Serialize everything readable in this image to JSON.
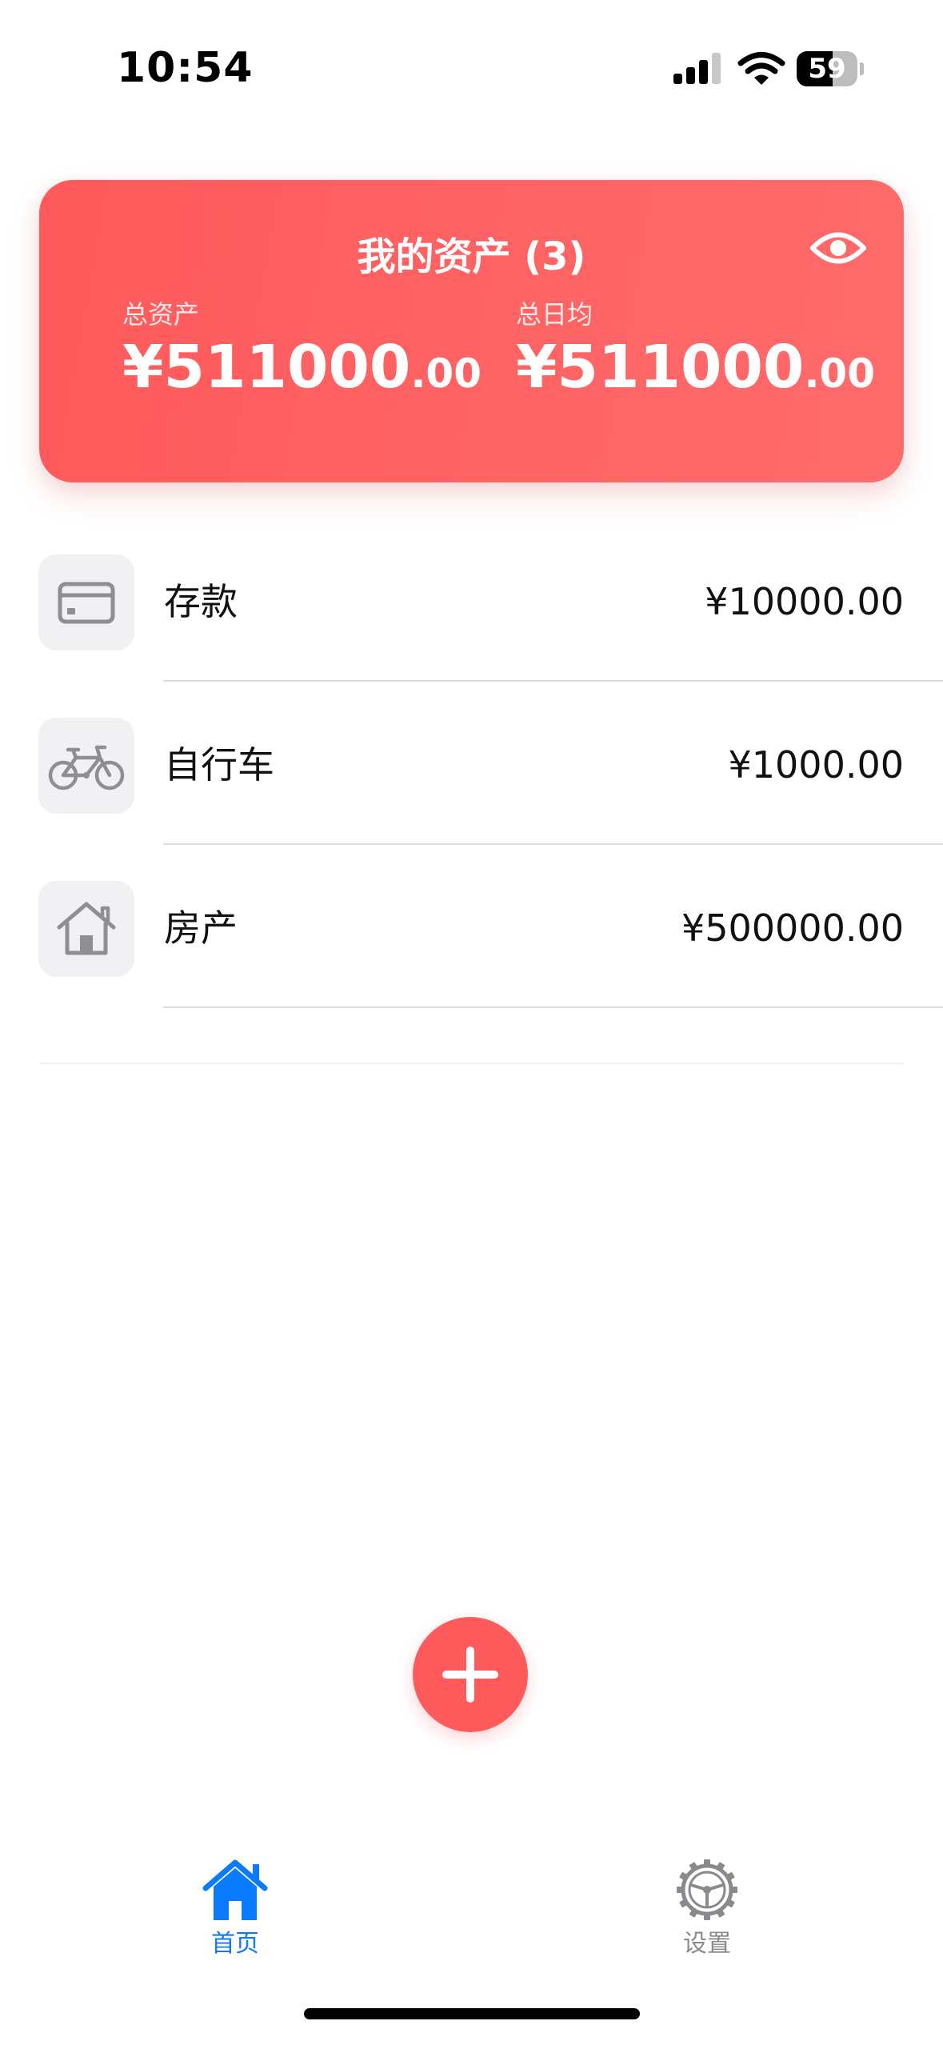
{
  "status_bar": {
    "time": "10:54",
    "battery_level": "59",
    "icons": [
      "signal-icon",
      "wifi-icon",
      "battery-icon"
    ]
  },
  "asset_card": {
    "title": "我的资产 (3)",
    "visibility_icon": "eye-icon",
    "total_assets": {
      "label": "总资产",
      "amount": "¥511000",
      "decimals": ".00"
    },
    "daily_average": {
      "label": "总日均",
      "amount": "¥511000",
      "decimals": ".00"
    },
    "colors": {
      "start": "#ff5a5c",
      "end": "#ff6b6b"
    }
  },
  "assets": [
    {
      "icon": "credit-card-icon",
      "name": "存款",
      "value": "¥10000.00"
    },
    {
      "icon": "bicycle-icon",
      "name": "自行车",
      "value": "¥1000.00"
    },
    {
      "icon": "house-icon",
      "name": "房产",
      "value": "¥500000.00"
    }
  ],
  "fab": {
    "icon": "plus-icon",
    "color": "#ff5a5c"
  },
  "tab_bar": {
    "tabs": [
      {
        "label": "首页",
        "icon": "house-fill-icon",
        "active": true,
        "color": "#0a7aff"
      },
      {
        "label": "设置",
        "icon": "gear-icon",
        "active": false,
        "color": "#8a8a8e"
      }
    ]
  }
}
